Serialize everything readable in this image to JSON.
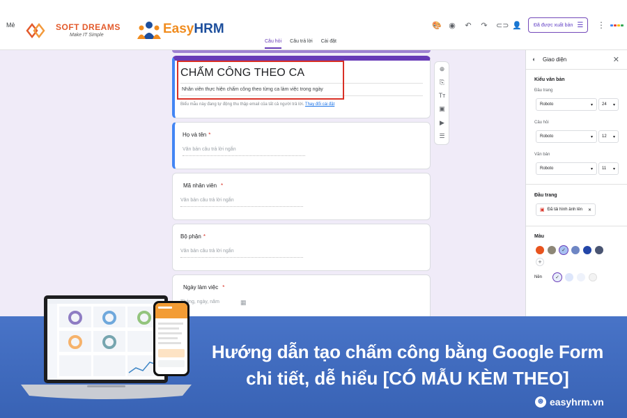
{
  "topbar": {
    "menu_label": "Mẻ",
    "brand1_title": "SOFT DREAMS",
    "brand1_sub": "Make IT Simple",
    "brand2_a": "Easy",
    "brand2_b": "HRM",
    "publish_label": "Đã được xuất bản",
    "icons": [
      "palette-icon",
      "preview-icon",
      "undo-icon",
      "redo-icon",
      "link-icon",
      "add-collaborator-icon",
      "more-icon"
    ]
  },
  "tabs": [
    {
      "label": "Câu hỏi",
      "active": true
    },
    {
      "label": "Câu trả lời",
      "active": false
    },
    {
      "label": "Cài đặt",
      "active": false
    }
  ],
  "form": {
    "title": "CHẤM CÔNG THEO CA",
    "description": "Nhân viên thực hiện chấm công theo từng ca làm việc trong ngày",
    "note": "Biểu mẫu này đang tự động thu thập email của tất cả người trả lời.",
    "note_link": "Thay đổi cài đặt"
  },
  "questions": [
    {
      "label": "Họ và tên",
      "required": "*",
      "placeholder": "Văn bản câu trả lời ngắn"
    },
    {
      "label": "Mã nhân viên",
      "required": "*",
      "placeholder": "Văn bản câu trả lời ngắn"
    },
    {
      "label": "Bộ phận",
      "required": "*",
      "placeholder": "Văn bản câu trả lời ngắn"
    },
    {
      "label": "Ngày làm việc",
      "required": "*",
      "placeholder": "Tháng, ngày, năm"
    }
  ],
  "float_tools": [
    "add-question-icon",
    "import-questions-icon",
    "add-title-icon",
    "add-image-icon",
    "add-video-icon",
    "add-section-icon"
  ],
  "panel": {
    "title": "Giao diện",
    "text_style": "Kiểu văn bản",
    "header_label": "Đầu trang",
    "header_font": "Roboto",
    "header_size": "24",
    "question_label": "Câu hỏi",
    "question_font": "Roboto",
    "question_size": "12",
    "text_label": "Văn bản",
    "text_font": "Roboto",
    "text_size": "11",
    "header_image_section": "Đầu trang",
    "header_image_chip": "Đã tải hình ảnh lên",
    "color_section": "Màu",
    "background_label": "Nền",
    "theme_colors": [
      "#e8541e",
      "#8d8777",
      "#a7c1f1",
      "#6e86c4",
      "#2346a8",
      "#4a5572"
    ],
    "background_colors": [
      "#e8eefb",
      "#dde6fb",
      "#eef2fb",
      "#f3f3f3"
    ]
  },
  "banner": {
    "line1": "Hướng dẫn tạo chấm công bằng Google Form",
    "line2": "chi tiết, dễ hiểu [CÓ MẪU KÈM THEO]",
    "site": "easyhrm.vn"
  }
}
